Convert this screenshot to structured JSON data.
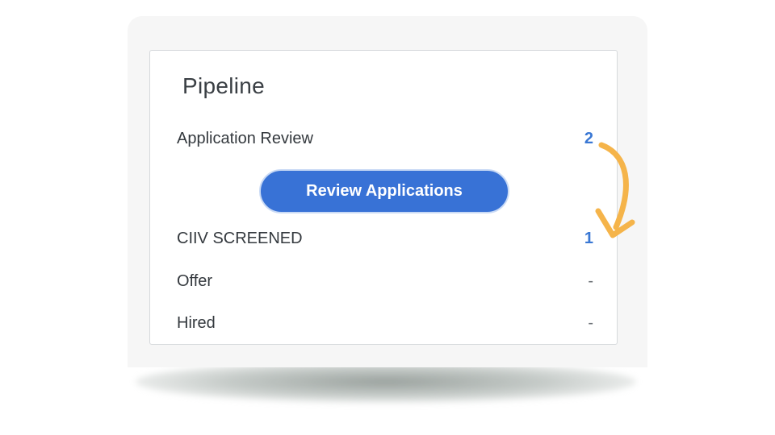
{
  "pipeline": {
    "title": "Pipeline",
    "stages": [
      {
        "label": "Application Review",
        "count": "2"
      },
      {
        "label": "CIIV SCREENED",
        "count": "1"
      },
      {
        "label": "Offer",
        "count": "-"
      },
      {
        "label": "Hired",
        "count": "-"
      }
    ],
    "review_button_label": "Review Applications"
  },
  "colors": {
    "accent": "#3872d6",
    "count_link": "#3a78d4",
    "arrow": "#f5b44a"
  },
  "annotation": {
    "icon": "curved-arrow-down-icon"
  }
}
